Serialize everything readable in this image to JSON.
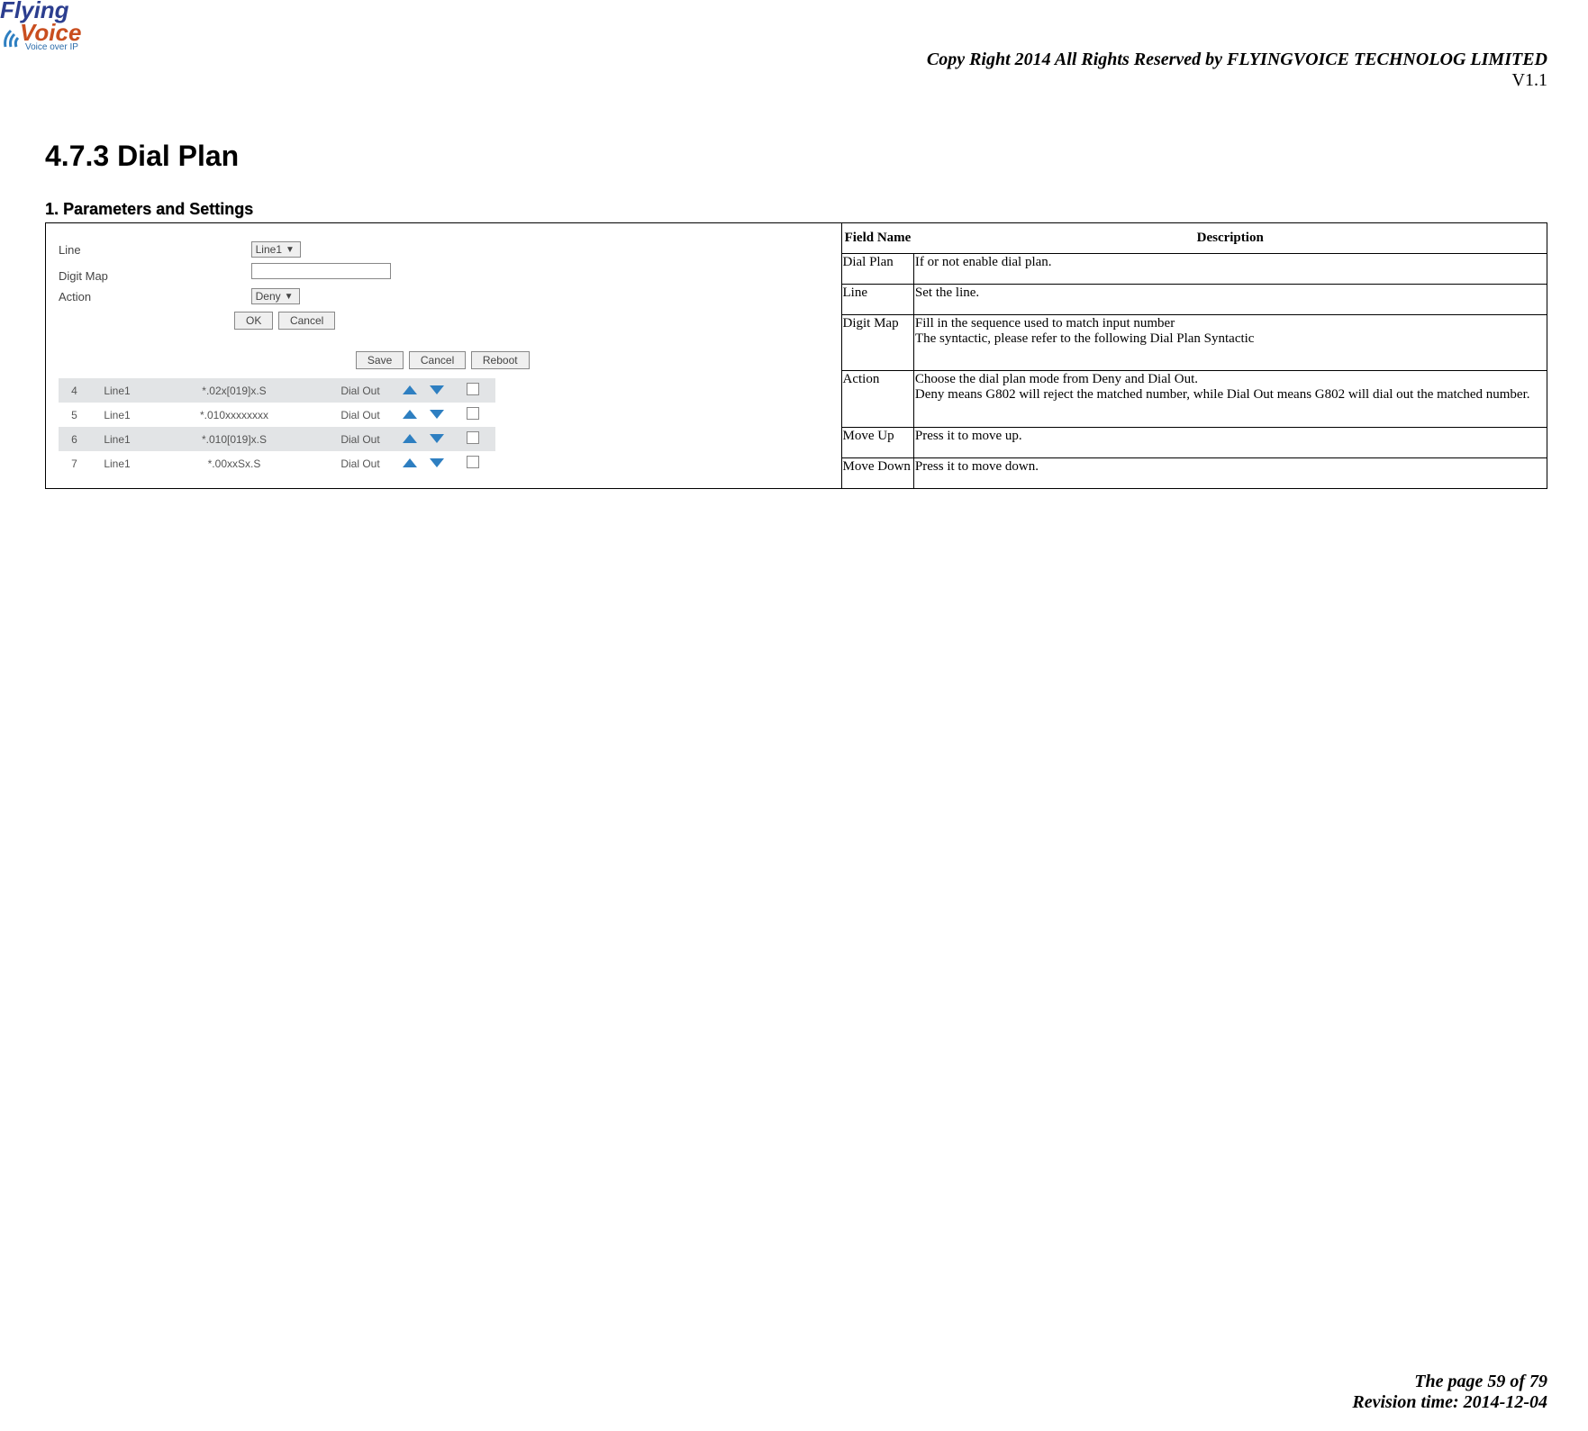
{
  "logo": {
    "top": "Flying",
    "bottom": "Voice",
    "tagline": "Voice over IP"
  },
  "header": {
    "copyright": "Copy Right 2014 All Rights Reserved by FLYINGVOICE TECHNOLOG LIMITED",
    "version": "V1.1"
  },
  "footer": {
    "page": "The page 59 of 79",
    "revision": "Revision time: 2014-12-04"
  },
  "section": {
    "title": "4.7.3 Dial Plan",
    "sub": "1.   Parameters and Settings"
  },
  "form": {
    "labels": {
      "line": "Line",
      "digit_map": "Digit Map",
      "action": "Action"
    },
    "values": {
      "line": "Line1",
      "action": "Deny"
    },
    "buttons": {
      "ok": "OK",
      "cancel": "Cancel",
      "save": "Save",
      "cancel2": "Cancel",
      "reboot": "Reboot"
    }
  },
  "rows": [
    {
      "idx": "4",
      "line": "Line1",
      "pattern": "*.02x[019]x.S",
      "mode": "Dial Out",
      "alt": true
    },
    {
      "idx": "5",
      "line": "Line1",
      "pattern": "*.010xxxxxxxx",
      "mode": "Dial Out",
      "alt": false
    },
    {
      "idx": "6",
      "line": "Line1",
      "pattern": "*.010[019]x.S",
      "mode": "Dial Out",
      "alt": true
    },
    {
      "idx": "7",
      "line": "Line1",
      "pattern": "*.00xxSx.S",
      "mode": "Dial Out",
      "alt": false
    }
  ],
  "desc": {
    "header": {
      "field": "Field Name",
      "desc": "Description"
    },
    "items": [
      {
        "name": "Dial Plan",
        "text": "If or not enable dial plan."
      },
      {
        "name": "Line",
        "text": "Set the line."
      },
      {
        "name": "Digit Map",
        "text": "Fill in the sequence used to match input number\nThe syntactic, please refer to the following Dial Plan Syntactic"
      },
      {
        "name": "Action",
        "text": "Choose the dial plan mode from Deny and Dial Out.\nDeny means G802 will reject the matched number, while Dial Out means G802 will dial out the matched number."
      },
      {
        "name": "Move Up",
        "text": "Press it to move up."
      },
      {
        "name": "Move Down",
        "text": "Press it to move down."
      }
    ]
  }
}
